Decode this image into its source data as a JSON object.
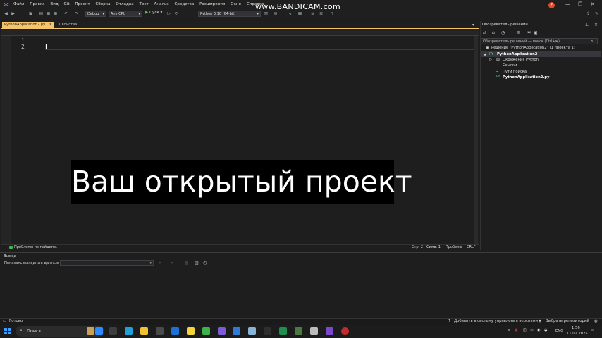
{
  "menu": [
    "Файл",
    "Правка",
    "Вид",
    "Git",
    "Проект",
    "Сборка",
    "Отладка",
    "Тест",
    "Анализ",
    "Средства",
    "Расширения",
    "Окно",
    "Справка"
  ],
  "watermark": "www.BANDICAM.com",
  "avatar_letter": "Z",
  "toolbar": {
    "config": "Debug",
    "platform": "Any CPU",
    "run_label": "Пуск",
    "env": "Python 3.10 (64-bit)"
  },
  "tabs": {
    "active": "PythonApplication2.py",
    "second": "Свойства"
  },
  "editor": {
    "line_numbers": [
      "1",
      "2"
    ],
    "overlay_caption": "Ваш открытый проект",
    "problems": "Проблемы не найдены.",
    "position_line": "Стр: 2",
    "position_col": "Симв: 1",
    "whitespace": "Пробелы",
    "eol": "CRLF"
  },
  "output": {
    "title": "Вывод",
    "show_from_label": "Показать выходные данные из:"
  },
  "solution_explorer": {
    "title": "Обозреватель решений",
    "search_placeholder": "Обозреватель решений — поиск (Ctrl+ж)",
    "tree": [
      {
        "label": "Решение \"PythonApplication2\" (1 проекта 1)",
        "bold": false
      },
      {
        "label": "PythonApplication2",
        "bold": true
      },
      {
        "label": "Окружения Python",
        "bold": false
      },
      {
        "label": "Ссылки",
        "bold": false
      },
      {
        "label": "Пути поиска",
        "bold": false
      },
      {
        "label": "PythonApplication2.py",
        "bold": true
      }
    ]
  },
  "statusbar": {
    "ready": "Готово",
    "add_vcs": "Добавить в систему управления версиями",
    "select_repo": "Выбрать репозиторий"
  },
  "taskbar": {
    "search": "Поиск",
    "lang": "ENG",
    "time": "1:56",
    "date": "11.02.2025"
  }
}
